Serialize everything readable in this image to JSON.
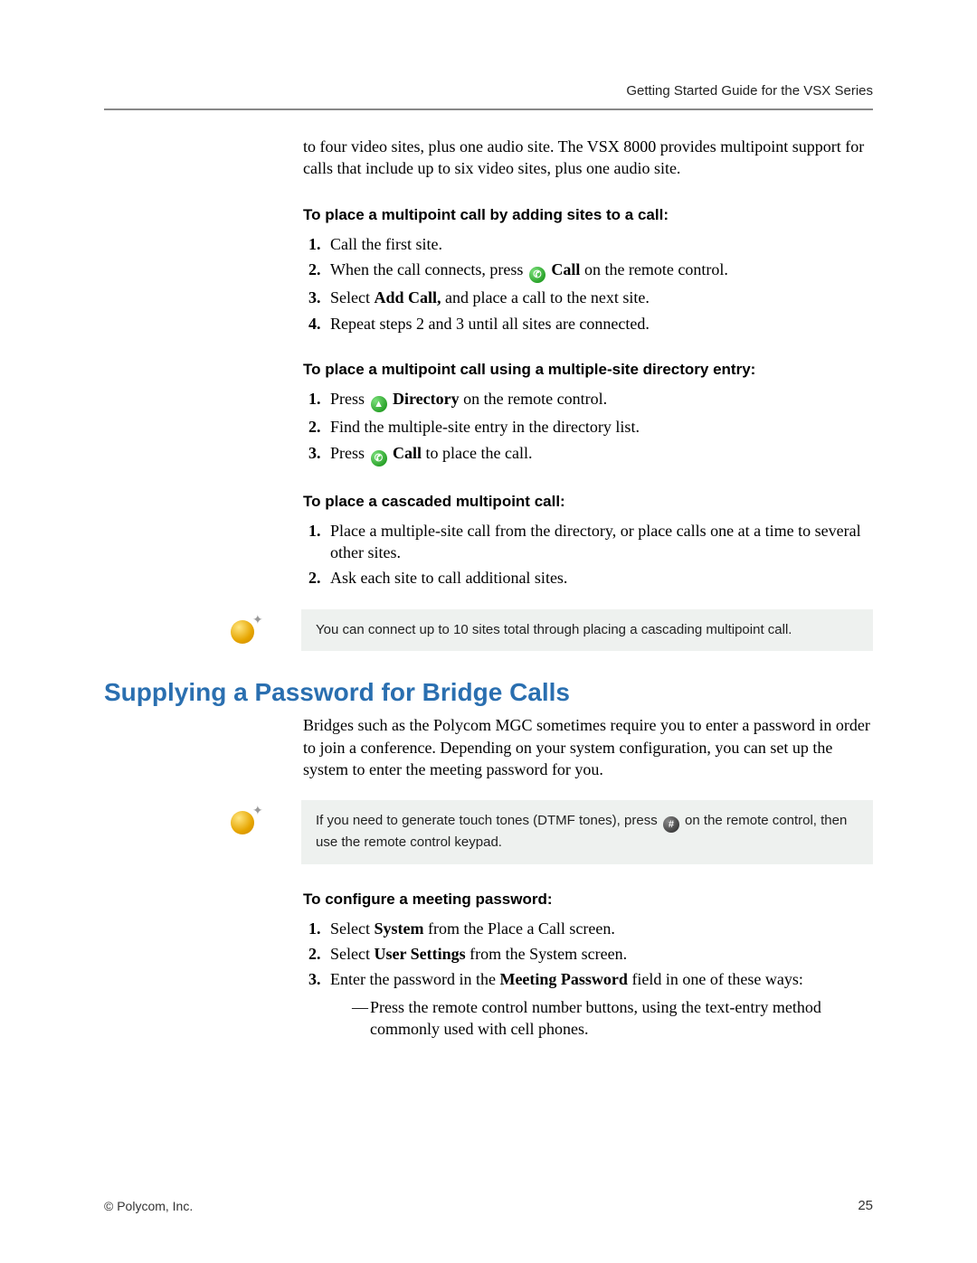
{
  "header": {
    "running_head": "Getting Started Guide for the VSX Series"
  },
  "intro_continuation": "to four video sites, plus one audio site. The VSX 8000 provides multipoint support for calls that include up to six video sites, plus one audio site.",
  "sectionA": {
    "subhead": "To place a multipoint call by adding sites to a call:",
    "steps": {
      "s1": "Call the first site.",
      "s2a": "When the call connects, press ",
      "s2b_bold": "Call",
      "s2c": " on the remote control.",
      "s3a": "Select ",
      "s3b_bold": "Add Call,",
      "s3c": " and place a call to the next site.",
      "s4": "Repeat steps 2 and 3 until all sites are connected."
    }
  },
  "sectionB": {
    "subhead": "To place a multipoint call using a multiple-site directory entry:",
    "steps": {
      "s1a": "Press ",
      "s1b_bold": "Directory",
      "s1c": " on the remote control.",
      "s2": "Find the multiple-site entry in the directory list.",
      "s3a": "Press ",
      "s3b_bold": "Call",
      "s3c": " to place the call."
    }
  },
  "sectionC": {
    "subhead": "To place a cascaded multipoint call:",
    "steps": {
      "s1": "Place a multiple-site call from the directory, or place calls one at a time to several other sites.",
      "s2": "Ask each site to call additional sites."
    }
  },
  "note1": "You can connect up to 10 sites total through placing a cascading multipoint call.",
  "heading2": "Supplying a Password for Bridge Calls",
  "bridge_intro": "Bridges such as the Polycom MGC sometimes require you to enter a password in order to join a conference. Depending on your system configuration, you can set up the system to enter the meeting password for you.",
  "note2a": "If you need to generate touch tones (DTMF tones), press ",
  "note2b": " on the remote control, then use the remote control keypad.",
  "sectionD": {
    "subhead": "To configure a meeting password:",
    "steps": {
      "s1a": "Select ",
      "s1b_bold": "System",
      "s1c": " from the Place a Call screen.",
      "s2a": "Select ",
      "s2b_bold": "User Settings",
      "s2c": " from the System screen.",
      "s3a": "Enter the password in the ",
      "s3b_bold": "Meeting Password",
      "s3c": " field in one of these ways:",
      "sub1": "Press the remote control number buttons, using the text-entry method commonly used with cell phones."
    }
  },
  "footer": {
    "left": "© Polycom, Inc.",
    "right": "25"
  },
  "icons": {
    "call_glyph": "✆",
    "dir_glyph": "▲",
    "hash_glyph": "#"
  }
}
